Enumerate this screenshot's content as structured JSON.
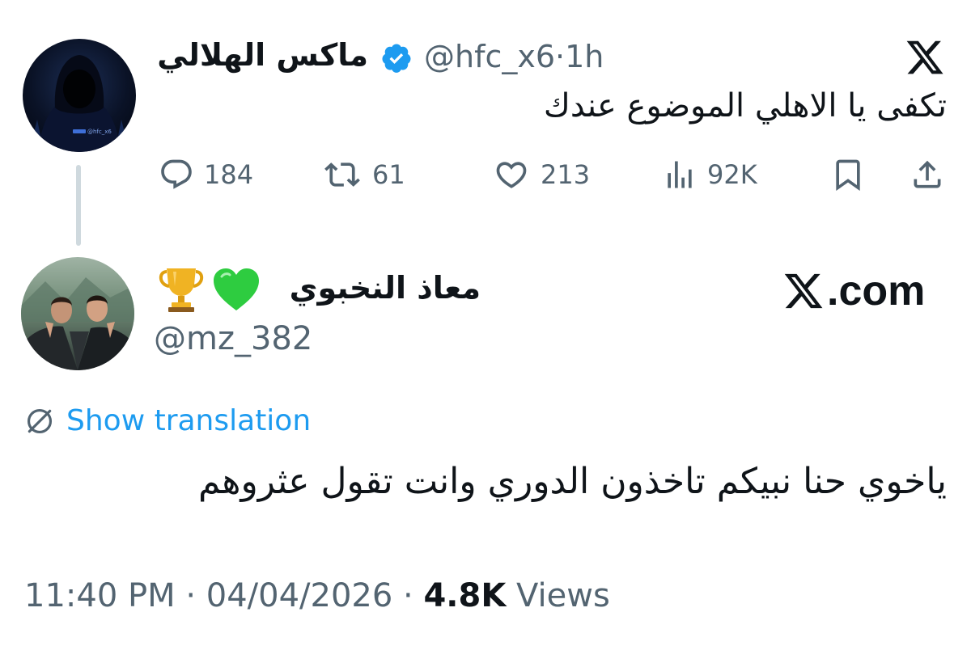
{
  "app": {
    "brand": "X",
    "site_label": ".com"
  },
  "parent_tweet": {
    "display_name": "ماكس الهلالي",
    "verified": true,
    "handle": "@hfc_x6",
    "separator": "·",
    "time": "1h",
    "text": "تكفى يا الاهلي الموضوع عندك",
    "avatar_watermark": "@hfc_x6",
    "actions": {
      "reply_count": "184",
      "retweet_count": "61",
      "like_count": "213",
      "views_count": "92K"
    }
  },
  "reply_tweet": {
    "display_name": "معاذ النخبوي",
    "handle": "@mz_382",
    "show_translation": "Show translation",
    "text": "ياخوي حنا نبيكم تاخذون الدوري وانت تقول عثروهم",
    "timestamp": "11:40 PM · 04/04/2026 · ",
    "views_value": "4.8K",
    "views_label": " Views"
  },
  "colors": {
    "link_blue": "#1d9bf0",
    "muted_gray": "#536471",
    "text_black": "#0f1419",
    "thread_line": "#cfd9de",
    "heart_green": "#2ecc40",
    "trophy_gold": "#f0b323"
  },
  "icons": {
    "reply": "comment-icon",
    "retweet": "retweet-icon",
    "like": "heart-icon",
    "views": "analytics-icon",
    "bookmark": "bookmark-icon",
    "share": "share-icon",
    "verified": "verified-badge-icon",
    "translate": "translate-globe-icon",
    "logo": "x-logo-icon"
  }
}
